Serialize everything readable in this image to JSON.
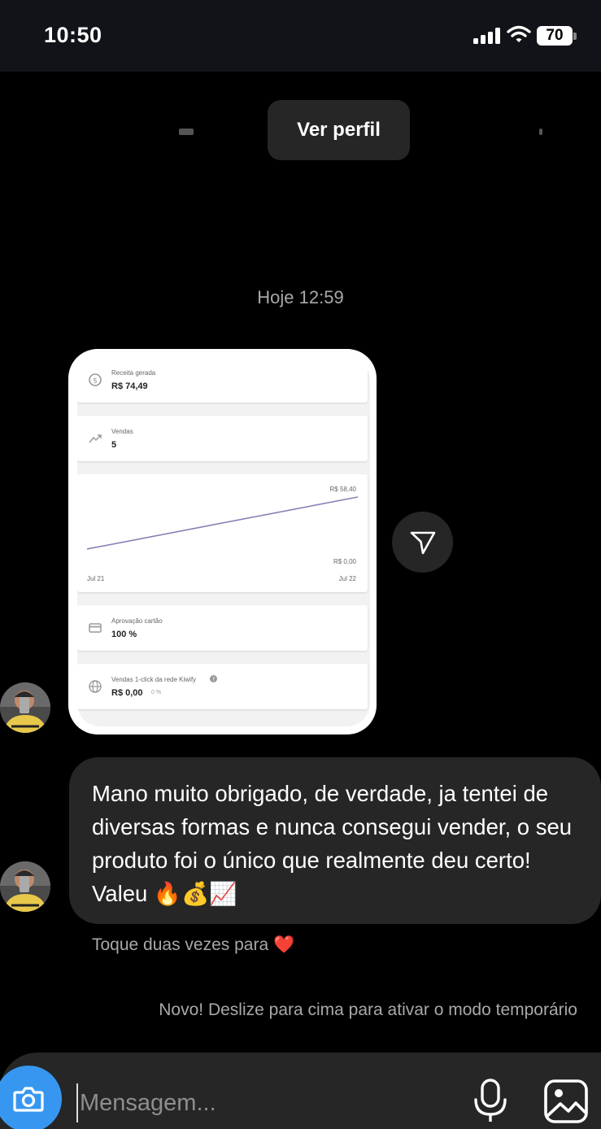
{
  "status_bar": {
    "time": "10:50",
    "battery": "70"
  },
  "profile_button": {
    "label": "Ver perfil"
  },
  "timestamp": "Hoje 12:59",
  "shared_image": {
    "revenue": {
      "label": "Receita gerada",
      "value": "R$ 74,49"
    },
    "sales": {
      "label": "Vendas",
      "value": "5"
    },
    "chart": {
      "max_label": "R$ 58,40",
      "min_label": "R$ 0,00",
      "x_start": "Jul 21",
      "x_end": "Jul 22"
    },
    "approval": {
      "label": "Aprovação cartão",
      "value": "100 %"
    },
    "oneclick": {
      "label": "Vendas 1-click da rede Kiwify",
      "value": "R$ 0,00",
      "pct": "0 %"
    }
  },
  "message": {
    "text": "Mano muito obrigado, de verdade, ja tentei de diversas formas e nunca consegui vender, o seu produto foi o único que realmente deu certo! Valeu 🔥💰📈"
  },
  "double_tap_hint": "Toque duas vezes para ❤️",
  "temporary_mode_notice": "Novo! Deslize para cima para ativar o modo temporário",
  "composer": {
    "placeholder": "Mensagem..."
  },
  "colors": {
    "background": "#000000",
    "bubble": "#262626",
    "accent": "#3797f0",
    "chart_line": "#8a7fb5"
  },
  "icons": [
    "signal-icon",
    "wifi-icon",
    "battery-icon",
    "send-icon",
    "camera-icon",
    "microphone-icon",
    "gallery-icon"
  ]
}
